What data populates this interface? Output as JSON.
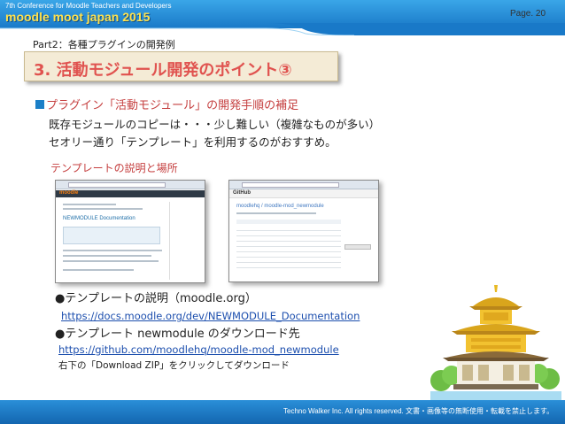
{
  "header": {
    "conference_line": "7th Conference for Moodle Teachers and Developers",
    "title": "moodle moot japan 2015",
    "page_number": "Page. 20"
  },
  "slide": {
    "part_label": "Part2：各種プラグインの開発例",
    "section_title": "3. 活動モジュール開発のポイント③",
    "bullet_heading": "プラグイン「活動モジュール」の開発手順の補足",
    "line1": "既存モジュールのコピーは・・・少し難しい（複雑なものが多い）",
    "line2": "セオリー通り「テンプレート」を利用するのがおすすめ。",
    "template_heading": "テンプレートの説明と場所",
    "item1_label": "●テンプレートの説明（moodle.org）",
    "item1_url": "https://docs.moodle.org/dev/NEWMODULE_Documentation",
    "item2_label": "●テンプレート newmodule のダウンロード先",
    "item2_url": "https://github.com/moodlehq/moodle-mod_newmodule",
    "item2_note": "右下の「Download ZIP」をクリックしてダウンロード"
  },
  "screenshots": {
    "moodle_logo": "moodle",
    "moodle_heading": "NEWMODULE Documentation",
    "github_logo": "GitHub",
    "github_heading": "moodlehq / moodle-mod_newmodule"
  },
  "footer": {
    "copyright": "Techno Walker Inc. All rights reserved.  文書・画像等の無断使用・転載を禁止します。"
  },
  "colors": {
    "header_blue": "#1979c8",
    "title_yellow": "#ffe14d",
    "section_red": "#e0524f",
    "link_blue": "#1d4fae"
  },
  "icons": [
    "temple-illustration-icon",
    "bullet-square-icon"
  ]
}
